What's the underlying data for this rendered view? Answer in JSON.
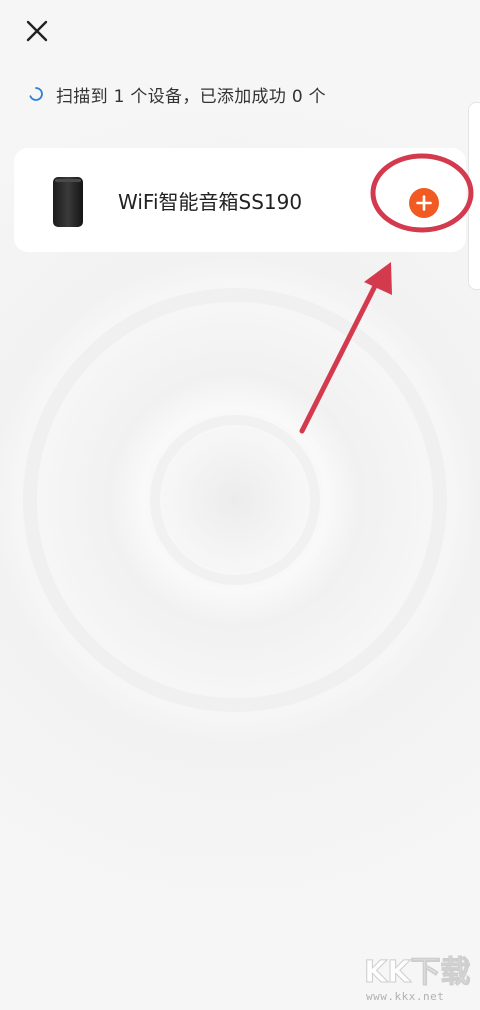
{
  "header": {
    "close_icon": "close-icon"
  },
  "scan_status": {
    "spinner_icon": "loading-spinner-icon",
    "text": "扫描到 1 个设备，已添加成功 0 个"
  },
  "devices": [
    {
      "icon": "smart-speaker-icon",
      "name": "WiFi智能音箱SS190",
      "action_icon": "plus-icon"
    }
  ],
  "colors": {
    "accent_orange": "#f15a22",
    "annotation_red": "#d43a4e",
    "spinner_blue": "#2f7fd6",
    "background": "#f6f6f6"
  },
  "watermark": {
    "logo_text": "KK下载",
    "url": "www.kkx.net"
  }
}
